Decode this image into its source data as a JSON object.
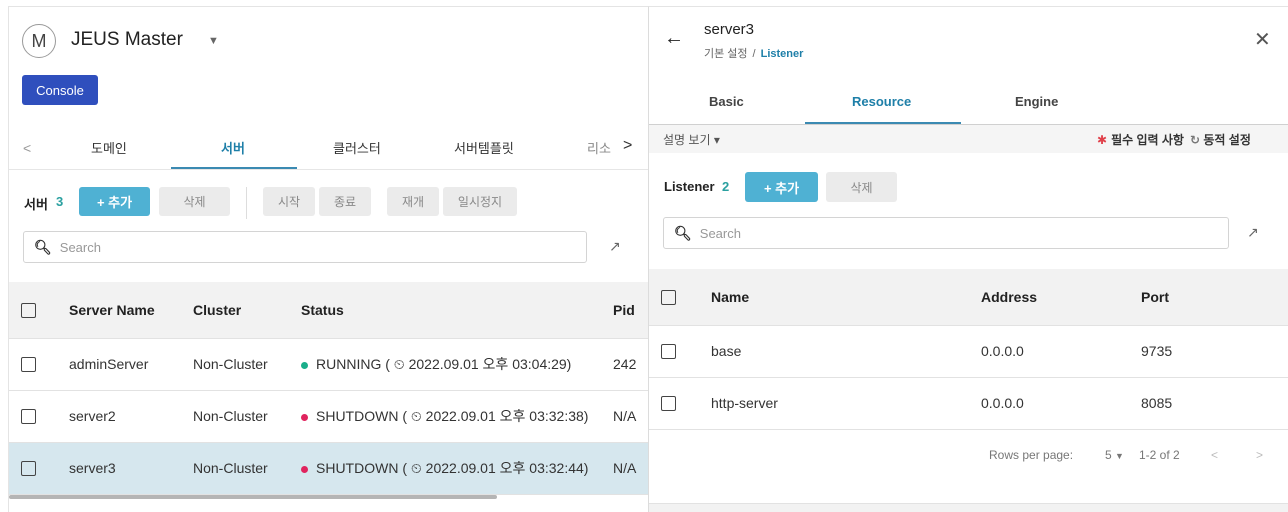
{
  "app": {
    "avatar_letter": "M",
    "title": "JEUS Master",
    "console_label": "Console"
  },
  "left_tabs": [
    {
      "label": "도메인"
    },
    {
      "label": "서버"
    },
    {
      "label": "클러스터"
    },
    {
      "label": "서버템플릿"
    },
    {
      "label": "리소"
    }
  ],
  "server_toolbar": {
    "label": "서버",
    "count": "3",
    "add": "+ 추가",
    "delete": "삭제",
    "start": "시작",
    "stop": "종료",
    "resume": "재개",
    "suspend": "일시정지"
  },
  "search": {
    "placeholder": "Search"
  },
  "server_table": {
    "headers": [
      "Server Name",
      "Cluster",
      "Status",
      "Pid"
    ],
    "rows": [
      {
        "name": "adminServer",
        "cluster": "Non-Cluster",
        "status": "RUNNING ( ⏲ 2022.09.01 오후 03:04:29)",
        "status_color": "#1aae8a",
        "pid": "242"
      },
      {
        "name": "server2",
        "cluster": "Non-Cluster",
        "status": "SHUTDOWN ( ⏲ 2022.09.01 오후 03:32:38)",
        "status_color": "#e0245e",
        "pid": "N/A"
      },
      {
        "name": "server3",
        "cluster": "Non-Cluster",
        "status": "SHUTDOWN ( ⏲ 2022.09.01 오후 03:32:44)",
        "status_color": "#e0245e",
        "pid": "N/A"
      }
    ]
  },
  "detail": {
    "title": "server3",
    "breadcrumb": [
      "기본 설정",
      "Listener"
    ],
    "tabs": [
      "Basic",
      "Resource",
      "Engine"
    ],
    "desc_toggle": "설명 보기 ▾",
    "required": "필수 입력 사항",
    "dynamic": "동적 설정",
    "listener_label": "Listener",
    "listener_count": "2",
    "add": "+ 추가",
    "delete": "삭제",
    "search_placeholder": "Search",
    "headers": [
      "Name",
      "Address",
      "Port"
    ],
    "rows": [
      {
        "name": "base",
        "address": "0.0.0.0",
        "port": "9735"
      },
      {
        "name": "http-server",
        "address": "0.0.0.0",
        "port": "8085"
      }
    ],
    "pager": {
      "rows_per_page": "Rows per page:",
      "size": "5",
      "range": "1-2 of 2"
    }
  },
  "colors": {
    "accent": "#1e7fa8",
    "primary_button": "#4fb1d3",
    "console_button": "#2f4fbd",
    "running": "#1aae8a",
    "shutdown": "#e0245e"
  }
}
